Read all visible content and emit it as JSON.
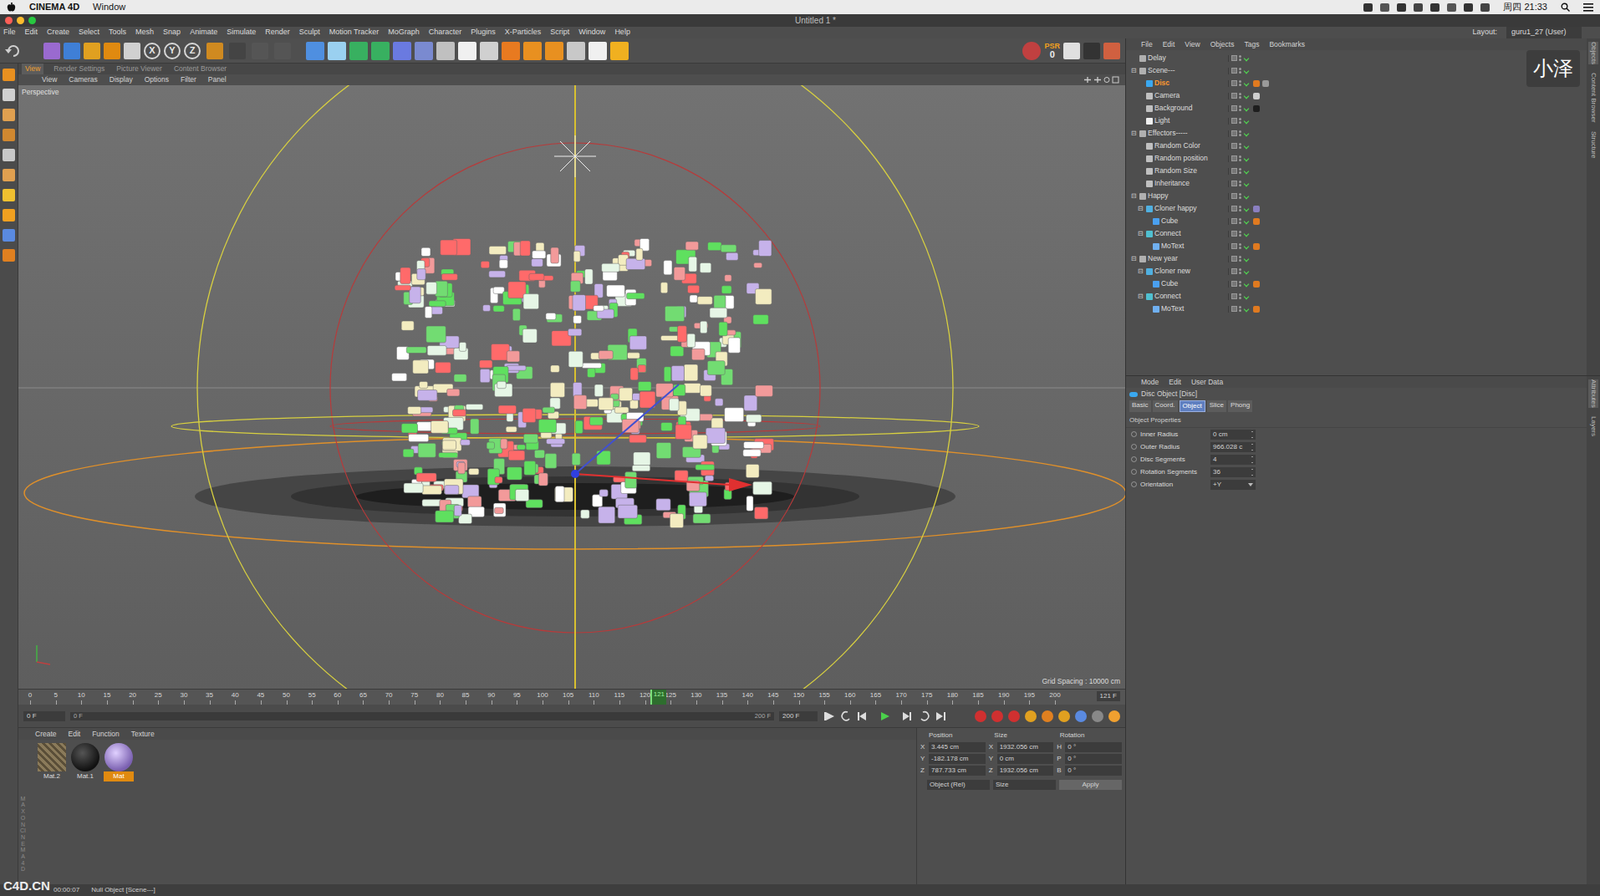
{
  "mac_menubar": {
    "app": "CINEMA 4D",
    "items": [
      "Window"
    ],
    "clock": "周四 21:33"
  },
  "window": {
    "title": "Untitled 1 *"
  },
  "menu": [
    "File",
    "Edit",
    "Create",
    "Select",
    "Tools",
    "Mesh",
    "Snap",
    "Animate",
    "Simulate",
    "Render",
    "Sculpt",
    "Motion Tracker",
    "MoGraph",
    "Character",
    "Plugins",
    "X-Particles",
    "Script",
    "Window",
    "Help"
  ],
  "layout": {
    "label": "Layout:",
    "value": "guru1_27 (User)"
  },
  "toolbar": {
    "axes": [
      "X",
      "Y",
      "Z"
    ],
    "psr_label": "PSR",
    "psr_value": "0"
  },
  "viewport": {
    "tabs": [
      {
        "label": "View",
        "selected": true
      },
      {
        "label": "Render Settings",
        "selected": false
      },
      {
        "label": "Picture Viewer",
        "selected": false
      },
      {
        "label": "Content Browser",
        "selected": false
      }
    ],
    "menu": [
      "View",
      "Cameras",
      "Display",
      "Options",
      "Filter",
      "Panel"
    ],
    "camera": "Perspective",
    "grid": "Grid Spacing : 10000 cm"
  },
  "timeline": {
    "ticks": [
      "0",
      "5",
      "10",
      "15",
      "20",
      "25",
      "30",
      "35",
      "40",
      "45",
      "50",
      "55",
      "60",
      "65",
      "70",
      "75",
      "80",
      "85",
      "90",
      "95",
      "100",
      "105",
      "110",
      "115",
      "120",
      "125",
      "130",
      "135",
      "140",
      "145",
      "150",
      "155",
      "160",
      "165",
      "170",
      "175",
      "180",
      "185",
      "190",
      "195",
      "200"
    ],
    "playhead": "121",
    "level": 0.605,
    "frame": "121 F",
    "start_field": "0 F",
    "range_start": "0 F",
    "range_end": "200 F",
    "end_field": "200 F"
  },
  "materials": {
    "menu": [
      "Create",
      "Edit",
      "Function",
      "Texture"
    ],
    "items": [
      {
        "name": "Mat.2",
        "kind": "texture",
        "selected": false
      },
      {
        "name": "Mat.1",
        "kind": "dark",
        "selected": false
      },
      {
        "name": "Mat",
        "kind": "purple",
        "selected": true
      }
    ]
  },
  "coordinates": {
    "headers": [
      "Position",
      "Size",
      "Rotation"
    ],
    "rows": [
      [
        {
          "axis": "X",
          "value": "3.445 cm"
        },
        {
          "axis": "X",
          "value": "1932.056 cm"
        },
        {
          "axis": "H",
          "value": "0 °"
        }
      ],
      [
        {
          "axis": "Y",
          "value": "-182.178 cm"
        },
        {
          "axis": "Y",
          "value": "0 cm"
        },
        {
          "axis": "P",
          "value": "0 °"
        }
      ],
      [
        {
          "axis": "Z",
          "value": "787.733 cm"
        },
        {
          "axis": "Z",
          "value": "1932.056 cm"
        },
        {
          "axis": "B",
          "value": "0 °"
        }
      ]
    ],
    "mode": "Object (Rel)",
    "size_mode": "Size",
    "apply": "Apply"
  },
  "objects": {
    "menu": [
      "File",
      "Edit",
      "View",
      "Objects",
      "Tags",
      "Bookmarks"
    ],
    "tree": [
      {
        "name": "Delay",
        "depth": 0,
        "toggle": "",
        "kind": "null",
        "selected": false,
        "enabled": true,
        "tags": []
      },
      {
        "name": "Scene---",
        "depth": 0,
        "toggle": "⊟",
        "kind": "null",
        "selected": false,
        "enabled": true,
        "tags": []
      },
      {
        "name": "Disc",
        "depth": 1,
        "toggle": "",
        "kind": "disc",
        "selected": true,
        "enabled": true,
        "tags": [
          "#e07a20",
          "#9a9a9a"
        ]
      },
      {
        "name": "Camera",
        "depth": 1,
        "toggle": "",
        "kind": "camera",
        "selected": false,
        "enabled": true,
        "tags": [
          "#cfcfcf"
        ]
      },
      {
        "name": "Background",
        "depth": 1,
        "toggle": "",
        "kind": "background",
        "selected": false,
        "enabled": true,
        "tags": [
          "#1e1e1e"
        ]
      },
      {
        "name": "Light",
        "depth": 1,
        "toggle": "",
        "kind": "light",
        "selected": false,
        "enabled": true,
        "tags": []
      },
      {
        "name": "Effectors-----",
        "depth": 0,
        "toggle": "⊟",
        "kind": "null",
        "selected": false,
        "enabled": true,
        "tags": []
      },
      {
        "name": "Random Color",
        "depth": 1,
        "toggle": "",
        "kind": "effector",
        "selected": false,
        "enabled": true,
        "tags": []
      },
      {
        "name": "Random position",
        "depth": 1,
        "toggle": "",
        "kind": "effector",
        "selected": false,
        "enabled": true,
        "tags": []
      },
      {
        "name": "Random Size",
        "depth": 1,
        "toggle": "",
        "kind": "effector",
        "selected": false,
        "enabled": true,
        "tags": []
      },
      {
        "name": "Inheritance",
        "depth": 1,
        "toggle": "",
        "kind": "effector",
        "selected": false,
        "enabled": true,
        "tags": []
      },
      {
        "name": "Happy",
        "depth": 0,
        "toggle": "⊟",
        "kind": "null",
        "selected": false,
        "enabled": true,
        "tags": []
      },
      {
        "name": "Cloner happy",
        "depth": 1,
        "toggle": "⊟",
        "kind": "cloner",
        "selected": false,
        "enabled": true,
        "tags": [
          "#8a7fc0"
        ]
      },
      {
        "name": "Cube",
        "depth": 2,
        "toggle": "",
        "kind": "cube",
        "selected": false,
        "enabled": true,
        "tags": [
          "#e07a20"
        ]
      },
      {
        "name": "Connect",
        "depth": 1,
        "toggle": "⊟",
        "kind": "connect",
        "selected": false,
        "enabled": true,
        "tags": []
      },
      {
        "name": "MoText",
        "depth": 2,
        "toggle": "",
        "kind": "motext",
        "selected": false,
        "enabled": true,
        "tags": [
          "#e07a20"
        ]
      },
      {
        "name": "New year",
        "depth": 0,
        "toggle": "⊟",
        "kind": "null",
        "selected": false,
        "enabled": true,
        "tags": []
      },
      {
        "name": "Cloner new",
        "depth": 1,
        "toggle": "⊟",
        "kind": "cloner",
        "selected": false,
        "enabled": true,
        "tags": []
      },
      {
        "name": "Cube",
        "depth": 2,
        "toggle": "",
        "kind": "cube",
        "selected": false,
        "enabled": true,
        "tags": [
          "#e07a20"
        ]
      },
      {
        "name": "Connect",
        "depth": 1,
        "toggle": "⊟",
        "kind": "connect",
        "selected": false,
        "enabled": true,
        "tags": []
      },
      {
        "name": "MoText",
        "depth": 2,
        "toggle": "",
        "kind": "motext",
        "selected": false,
        "enabled": true,
        "tags": [
          "#e07a20"
        ]
      }
    ]
  },
  "attributes": {
    "menu": [
      "Mode",
      "Edit",
      "User Data"
    ],
    "title": "Disc Object [Disc]",
    "tabs": [
      {
        "label": "Basic",
        "selected": false
      },
      {
        "label": "Coord.",
        "selected": false
      },
      {
        "label": "Object",
        "selected": true
      },
      {
        "label": "Slice",
        "selected": false
      },
      {
        "label": "Phong",
        "selected": false
      }
    ],
    "section": "Object Properties",
    "fields": [
      {
        "label": "Inner Radius",
        "value": "0 cm",
        "kind": "number"
      },
      {
        "label": "Outer Radius",
        "value": "966.028 c",
        "kind": "number"
      },
      {
        "label": "Disc Segments",
        "value": "4",
        "kind": "number"
      },
      {
        "label": "Rotation Segments",
        "value": "36",
        "kind": "number"
      },
      {
        "label": "Orientation",
        "value": "+Y",
        "kind": "dropdown"
      }
    ]
  },
  "side_tabs": {
    "top": [
      "Objects",
      "Content Browser",
      "Structure"
    ],
    "bottom": [
      "Attributes",
      "Layers"
    ]
  },
  "brand": "MAXON CINEMA 4D",
  "watermarks": {
    "site": "C4D.CN",
    "author": "小泽"
  },
  "status_bar": {
    "time": "00:00:07",
    "message": "Null Object [Scene---]"
  }
}
